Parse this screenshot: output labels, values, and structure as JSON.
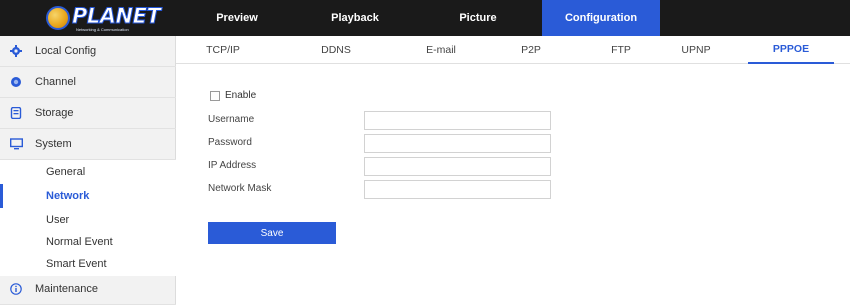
{
  "brand": {
    "name": "PLANET",
    "tagline": "Networking & Communication"
  },
  "colors": {
    "accent": "#2a5bd7",
    "topbar": "#1a1a1a",
    "sidebar": "#f2f2f2"
  },
  "topnav": {
    "items": [
      {
        "label": "Preview"
      },
      {
        "label": "Playback"
      },
      {
        "label": "Picture"
      },
      {
        "label": "Configuration",
        "active": true
      }
    ]
  },
  "sidebar": {
    "items": [
      {
        "label": "Local Config",
        "icon": "gear-icon"
      },
      {
        "label": "Channel",
        "icon": "camera-icon"
      },
      {
        "label": "Storage",
        "icon": "storage-icon"
      },
      {
        "label": "System",
        "icon": "monitor-icon"
      }
    ],
    "subitems": [
      {
        "label": "General"
      },
      {
        "label": "Network",
        "active": true
      },
      {
        "label": "User"
      },
      {
        "label": "Normal Event"
      },
      {
        "label": "Smart Event"
      }
    ],
    "bottom_item": {
      "label": "Maintenance",
      "icon": "info-icon"
    }
  },
  "tabs": {
    "items": [
      {
        "label": "TCP/IP"
      },
      {
        "label": "DDNS"
      },
      {
        "label": "E-mail"
      },
      {
        "label": "P2P"
      },
      {
        "label": "FTP"
      },
      {
        "label": "UPNP"
      },
      {
        "label": "PPPOE",
        "active": true
      }
    ]
  },
  "form": {
    "enable_label": "Enable",
    "enable_checked": false,
    "fields": [
      {
        "label": "Username",
        "value": ""
      },
      {
        "label": "Password",
        "value": ""
      },
      {
        "label": "IP Address",
        "value": ""
      },
      {
        "label": "Network Mask",
        "value": ""
      }
    ],
    "save_label": "Save"
  }
}
